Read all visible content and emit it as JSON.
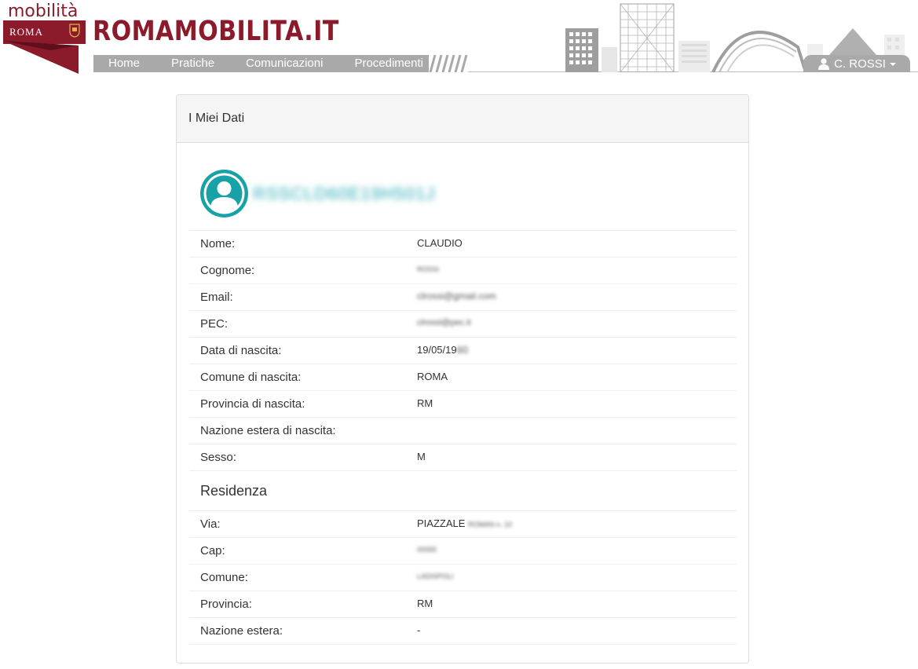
{
  "header": {
    "logo_top": "mobilità",
    "logo_city": "ROMA",
    "brand": "ROMAMOBILITA.IT",
    "nav": [
      "Home",
      "Pratiche",
      "Comunicazioni",
      "Procedimenti"
    ],
    "user_label": "C. ROSSI",
    "brand_color": "#8b1a2b",
    "nav_color": "#a9a9a9"
  },
  "panel": {
    "title": "I Miei Dati",
    "codice_fiscale": "RSSCLD60E19H501J",
    "avatar_color": "#17a2a8",
    "personal": [
      {
        "label": "Nome:",
        "value": "CLAUDIO"
      },
      {
        "label": "Cognome:",
        "value": "ROSSI"
      },
      {
        "label": "Email:",
        "value": "clrossi@gmail.com"
      },
      {
        "label": "PEC:",
        "value": "clrossi@pec.it"
      },
      {
        "label": "Data di nascita:",
        "value": "19/05/19",
        "value_hidden": "60"
      },
      {
        "label": "Comune di nascita:",
        "value": "ROMA"
      },
      {
        "label": "Provincia di nascita:",
        "value": "RM"
      },
      {
        "label": "Nazione estera di nascita:",
        "value": ""
      },
      {
        "label": "Sesso:",
        "value": "M"
      }
    ],
    "residenza_title": "Residenza",
    "residenza": [
      {
        "label": "Via:",
        "value": "PIAZZALE",
        "value_hidden": "ROMAN n. 10"
      },
      {
        "label": "Cap:",
        "value": "00055"
      },
      {
        "label": "Comune:",
        "value": "LADISPOLI"
      },
      {
        "label": "Provincia:",
        "value": "RM"
      },
      {
        "label": "Nazione estera:",
        "value": "-"
      }
    ]
  }
}
